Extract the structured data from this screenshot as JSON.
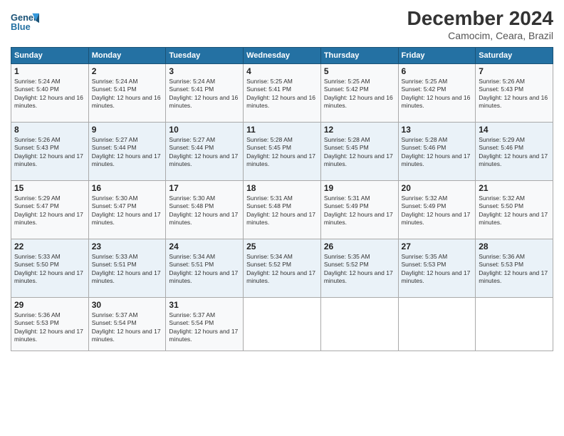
{
  "header": {
    "logo_text_general": "General",
    "logo_text_blue": "Blue",
    "month_title": "December 2024",
    "location": "Camocim, Ceara, Brazil"
  },
  "weekdays": [
    "Sunday",
    "Monday",
    "Tuesday",
    "Wednesday",
    "Thursday",
    "Friday",
    "Saturday"
  ],
  "weeks": [
    [
      {
        "day": "1",
        "sunrise": "5:24 AM",
        "sunset": "5:40 PM",
        "daylight": "12 hours and 16 minutes."
      },
      {
        "day": "2",
        "sunrise": "5:24 AM",
        "sunset": "5:41 PM",
        "daylight": "12 hours and 16 minutes."
      },
      {
        "day": "3",
        "sunrise": "5:24 AM",
        "sunset": "5:41 PM",
        "daylight": "12 hours and 16 minutes."
      },
      {
        "day": "4",
        "sunrise": "5:25 AM",
        "sunset": "5:41 PM",
        "daylight": "12 hours and 16 minutes."
      },
      {
        "day": "5",
        "sunrise": "5:25 AM",
        "sunset": "5:42 PM",
        "daylight": "12 hours and 16 minutes."
      },
      {
        "day": "6",
        "sunrise": "5:25 AM",
        "sunset": "5:42 PM",
        "daylight": "12 hours and 16 minutes."
      },
      {
        "day": "7",
        "sunrise": "5:26 AM",
        "sunset": "5:43 PM",
        "daylight": "12 hours and 16 minutes."
      }
    ],
    [
      {
        "day": "8",
        "sunrise": "5:26 AM",
        "sunset": "5:43 PM",
        "daylight": "12 hours and 17 minutes."
      },
      {
        "day": "9",
        "sunrise": "5:27 AM",
        "sunset": "5:44 PM",
        "daylight": "12 hours and 17 minutes."
      },
      {
        "day": "10",
        "sunrise": "5:27 AM",
        "sunset": "5:44 PM",
        "daylight": "12 hours and 17 minutes."
      },
      {
        "day": "11",
        "sunrise": "5:28 AM",
        "sunset": "5:45 PM",
        "daylight": "12 hours and 17 minutes."
      },
      {
        "day": "12",
        "sunrise": "5:28 AM",
        "sunset": "5:45 PM",
        "daylight": "12 hours and 17 minutes."
      },
      {
        "day": "13",
        "sunrise": "5:28 AM",
        "sunset": "5:46 PM",
        "daylight": "12 hours and 17 minutes."
      },
      {
        "day": "14",
        "sunrise": "5:29 AM",
        "sunset": "5:46 PM",
        "daylight": "12 hours and 17 minutes."
      }
    ],
    [
      {
        "day": "15",
        "sunrise": "5:29 AM",
        "sunset": "5:47 PM",
        "daylight": "12 hours and 17 minutes."
      },
      {
        "day": "16",
        "sunrise": "5:30 AM",
        "sunset": "5:47 PM",
        "daylight": "12 hours and 17 minutes."
      },
      {
        "day": "17",
        "sunrise": "5:30 AM",
        "sunset": "5:48 PM",
        "daylight": "12 hours and 17 minutes."
      },
      {
        "day": "18",
        "sunrise": "5:31 AM",
        "sunset": "5:48 PM",
        "daylight": "12 hours and 17 minutes."
      },
      {
        "day": "19",
        "sunrise": "5:31 AM",
        "sunset": "5:49 PM",
        "daylight": "12 hours and 17 minutes."
      },
      {
        "day": "20",
        "sunrise": "5:32 AM",
        "sunset": "5:49 PM",
        "daylight": "12 hours and 17 minutes."
      },
      {
        "day": "21",
        "sunrise": "5:32 AM",
        "sunset": "5:50 PM",
        "daylight": "12 hours and 17 minutes."
      }
    ],
    [
      {
        "day": "22",
        "sunrise": "5:33 AM",
        "sunset": "5:50 PM",
        "daylight": "12 hours and 17 minutes."
      },
      {
        "day": "23",
        "sunrise": "5:33 AM",
        "sunset": "5:51 PM",
        "daylight": "12 hours and 17 minutes."
      },
      {
        "day": "24",
        "sunrise": "5:34 AM",
        "sunset": "5:51 PM",
        "daylight": "12 hours and 17 minutes."
      },
      {
        "day": "25",
        "sunrise": "5:34 AM",
        "sunset": "5:52 PM",
        "daylight": "12 hours and 17 minutes."
      },
      {
        "day": "26",
        "sunrise": "5:35 AM",
        "sunset": "5:52 PM",
        "daylight": "12 hours and 17 minutes."
      },
      {
        "day": "27",
        "sunrise": "5:35 AM",
        "sunset": "5:53 PM",
        "daylight": "12 hours and 17 minutes."
      },
      {
        "day": "28",
        "sunrise": "5:36 AM",
        "sunset": "5:53 PM",
        "daylight": "12 hours and 17 minutes."
      }
    ],
    [
      {
        "day": "29",
        "sunrise": "5:36 AM",
        "sunset": "5:53 PM",
        "daylight": "12 hours and 17 minutes."
      },
      {
        "day": "30",
        "sunrise": "5:37 AM",
        "sunset": "5:54 PM",
        "daylight": "12 hours and 17 minutes."
      },
      {
        "day": "31",
        "sunrise": "5:37 AM",
        "sunset": "5:54 PM",
        "daylight": "12 hours and 17 minutes."
      },
      null,
      null,
      null,
      null
    ]
  ]
}
